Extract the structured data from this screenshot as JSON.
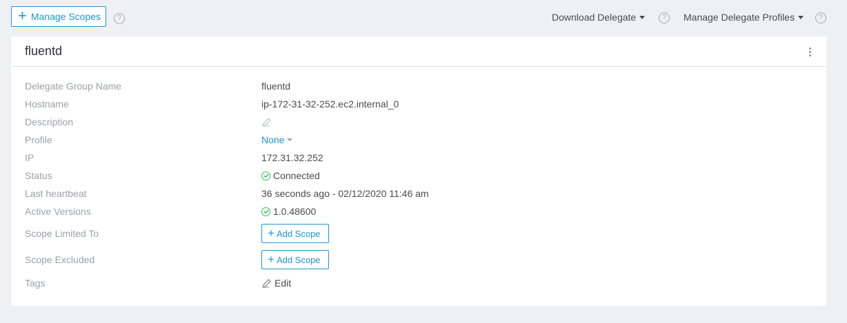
{
  "toolbar": {
    "manage_scopes_label": "Manage Scopes",
    "download_delegate_label": "Download Delegate",
    "manage_profiles_label": "Manage Delegate Profiles",
    "help_glyph": "?"
  },
  "delegate": {
    "title": "fluentd",
    "rows": {
      "group_name": {
        "label": "Delegate Group Name",
        "value": "fluentd"
      },
      "hostname": {
        "label": "Hostname",
        "value": "ip-172-31-32-252.ec2.internal_0"
      },
      "description": {
        "label": "Description"
      },
      "profile": {
        "label": "Profile",
        "value": "None"
      },
      "ip": {
        "label": "IP",
        "value": "172.31.32.252"
      },
      "status": {
        "label": "Status",
        "value": "Connected"
      },
      "last_heartbeat": {
        "label": "Last heartbeat",
        "value": "36 seconds ago - 02/12/2020 11:46 am"
      },
      "active_versions": {
        "label": "Active Versions",
        "value": "1.0.48600"
      },
      "scope_limited": {
        "label": "Scope Limited To",
        "button": "Add Scope"
      },
      "scope_excluded": {
        "label": "Scope Excluded",
        "button": "Add Scope"
      },
      "tags": {
        "label": "Tags",
        "edit": "Edit"
      }
    }
  },
  "colors": {
    "accent": "#1a96d4",
    "success": "#2dbd5d",
    "background": "#eef0f3"
  }
}
